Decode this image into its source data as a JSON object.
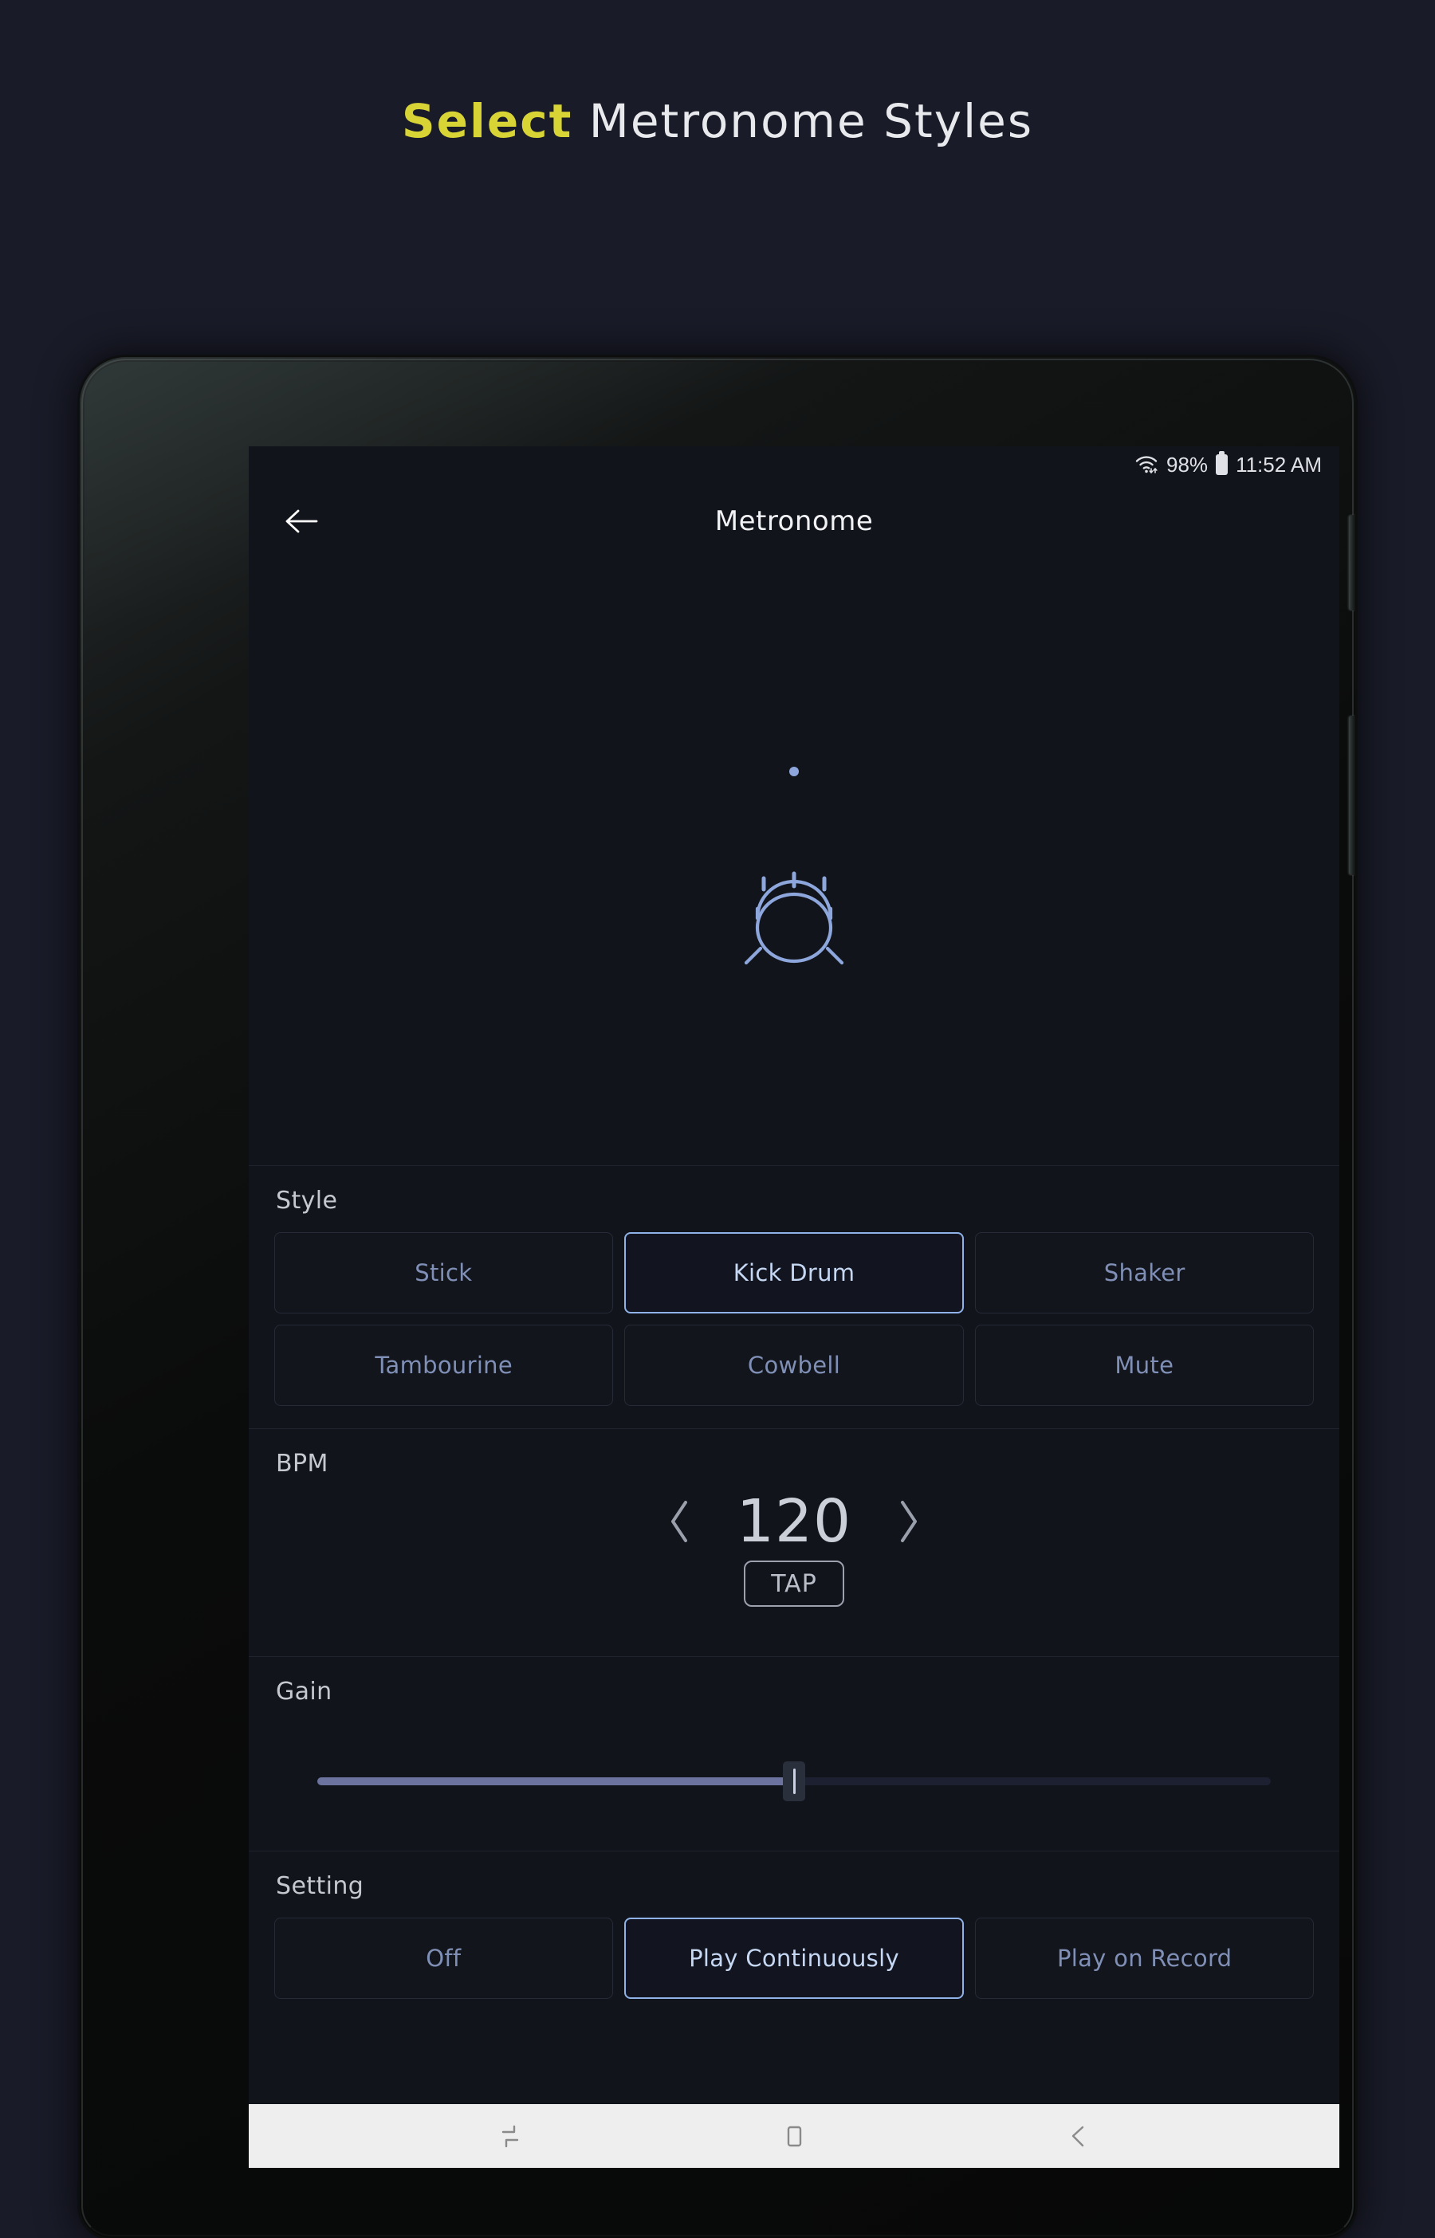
{
  "page": {
    "headline_accent": "Select",
    "headline_rest": " Metronome Styles",
    "bg_color": "#191b28",
    "accent_color": "#d8d436"
  },
  "status_bar": {
    "wifi_icon": "wifi-icon",
    "battery_percent": "98%",
    "battery_icon": "battery-icon",
    "time": "11:52 AM"
  },
  "app_bar": {
    "back_icon": "arrow-left-icon",
    "title": "Metronome"
  },
  "hero": {
    "beat_indicator": "beat-dot",
    "instrument_icon": "kick-drum-icon",
    "icon_color": "#8da6db"
  },
  "style_section": {
    "label": "Style",
    "selected": "Kick Drum",
    "options_row1": [
      "Stick",
      "Kick Drum",
      "Shaker"
    ],
    "options_row2": [
      "Tambourine",
      "Cowbell",
      "Mute"
    ]
  },
  "bpm_section": {
    "label": "BPM",
    "decrease_icon": "chevron-left-icon",
    "value": "120",
    "increase_icon": "chevron-right-icon",
    "tap_label": "TAP"
  },
  "gain_section": {
    "label": "Gain",
    "value_percent": 50,
    "fill_color": "#6c739e"
  },
  "setting_section": {
    "label": "Setting",
    "selected": "Play Continuously",
    "options": [
      "Off",
      "Play Continuously",
      "Play on Record"
    ]
  },
  "nav_bar": {
    "recents_icon": "recents-icon",
    "home_icon": "home-square-icon",
    "back_icon": "back-arrow-icon"
  }
}
